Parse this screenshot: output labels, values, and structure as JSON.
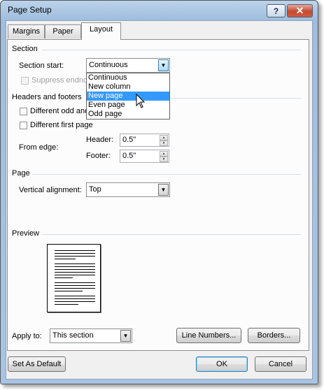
{
  "window": {
    "title": "Page Setup",
    "help_icon": "?",
    "close_icon": "✕"
  },
  "tabs": [
    {
      "label": "Margins",
      "active": false
    },
    {
      "label": "Paper",
      "active": false
    },
    {
      "label": "Layout",
      "active": true
    }
  ],
  "section": {
    "group_label": "Section",
    "start_label": "Section start:",
    "start_value": "Continuous",
    "dropdown_options": [
      "Continuous",
      "New column",
      "New page",
      "Even page",
      "Odd page"
    ],
    "highlighted_option": "New page",
    "suppress_label": "Suppress endnotes",
    "suppress_visible": "Suppress endnot"
  },
  "headers_footers": {
    "group_label": "Headers and footers",
    "odd_even_label": "Different odd and even",
    "odd_even_visible": "Different odd and",
    "first_page_label": "Different first page",
    "from_edge_label": "From edge:",
    "header_label": "Header:",
    "header_value": "0.5\"",
    "footer_label": "Footer:",
    "footer_value": "0.5\""
  },
  "page": {
    "group_label": "Page",
    "vertical_alignment_label": "Vertical alignment:",
    "vertical_alignment_value": "Top"
  },
  "preview": {
    "group_label": "Preview",
    "apply_to_label": "Apply to:",
    "apply_to_value": "This section",
    "line_numbers_button": "Line Numbers...",
    "borders_button": "Borders..."
  },
  "footer": {
    "set_default_button": "Set As Default",
    "ok_button": "OK",
    "cancel_button": "Cancel"
  },
  "colors": {
    "selection": "#3399ff",
    "title_bar": "#a9c4e2",
    "close_button": "#c44a2f"
  }
}
